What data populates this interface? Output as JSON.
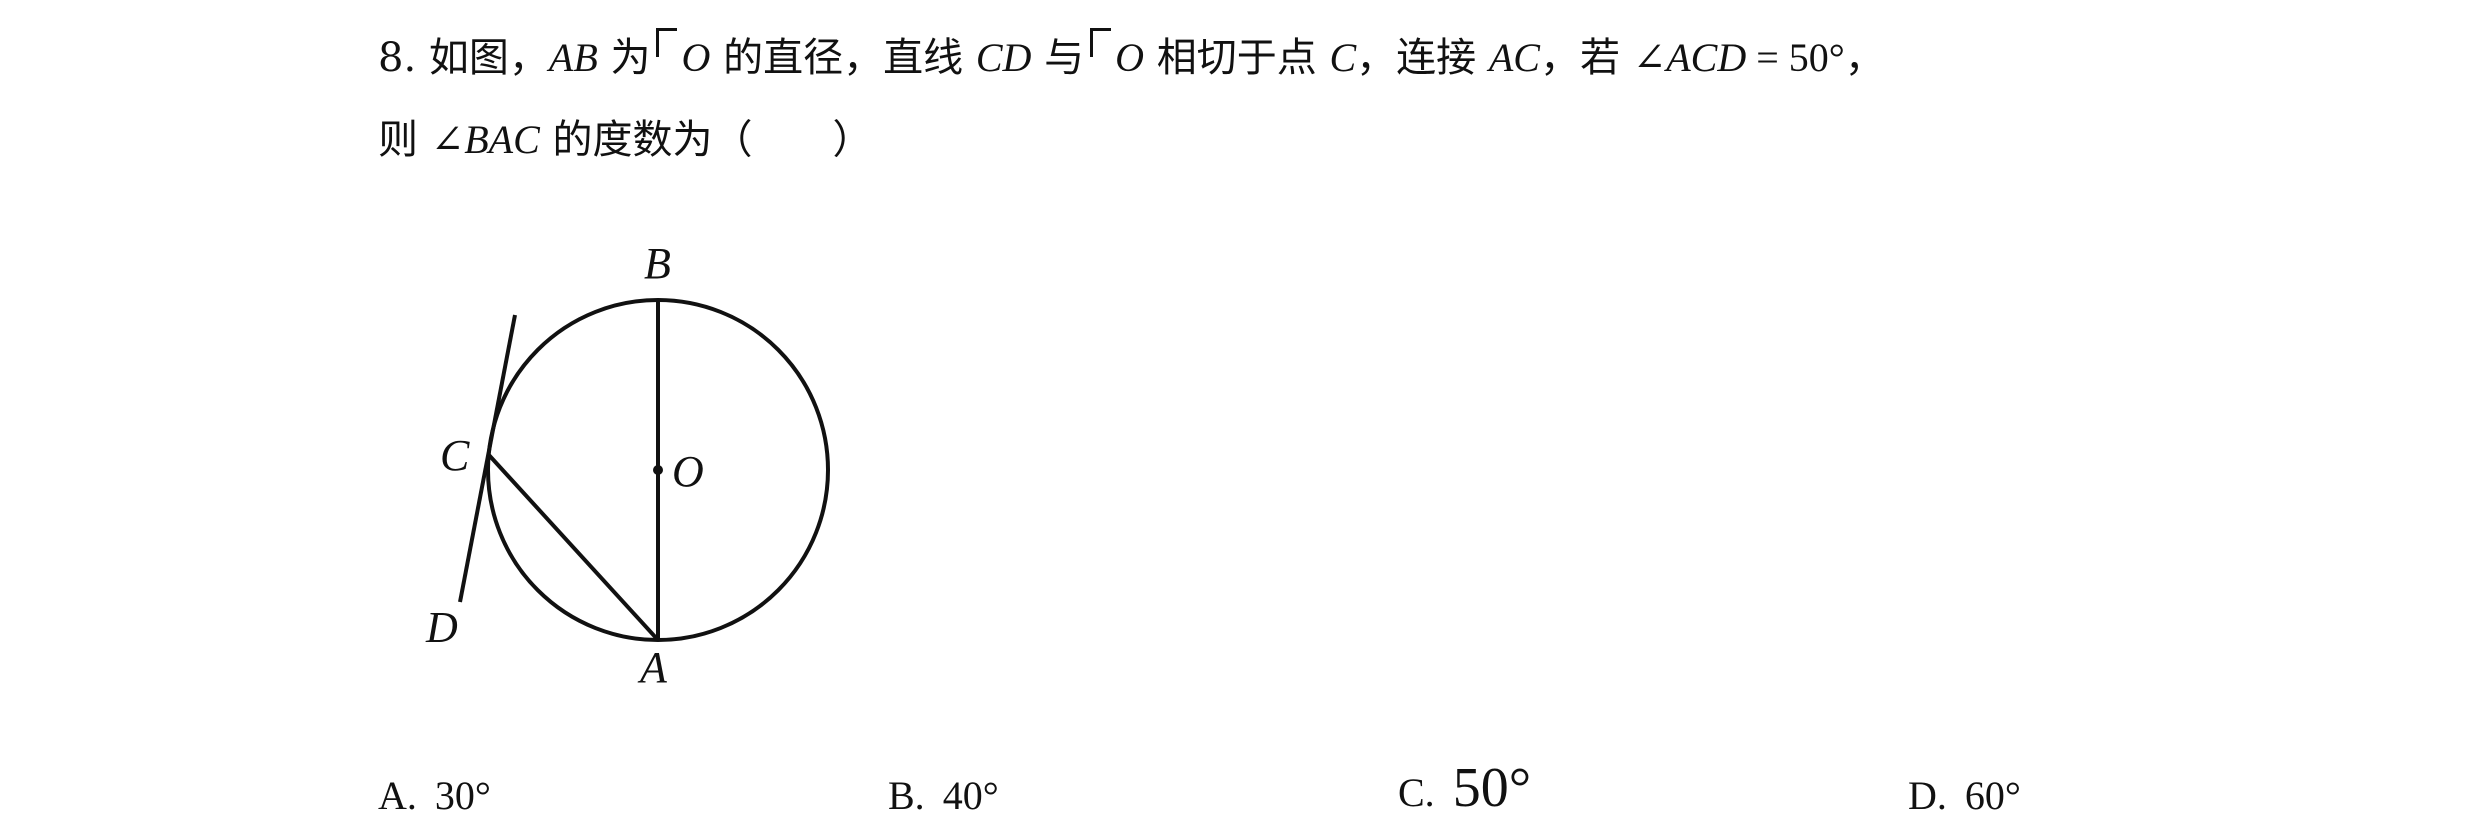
{
  "question": {
    "number": "8.",
    "line1": [
      {
        "t": "如图，",
        "s": "cjk"
      },
      {
        "t": "AB",
        "s": "math"
      },
      {
        "t": " 为",
        "s": "cjk"
      },
      {
        "t": "",
        "s": "circ"
      },
      {
        "t": "O",
        "s": "math"
      },
      {
        "t": " 的直径，直线 ",
        "s": "cjk"
      },
      {
        "t": "CD",
        "s": "math"
      },
      {
        "t": " 与",
        "s": "cjk"
      },
      {
        "t": "",
        "s": "circ"
      },
      {
        "t": "O",
        "s": "math"
      },
      {
        "t": " 相切于点 ",
        "s": "cjk"
      },
      {
        "t": "C",
        "s": "math"
      },
      {
        "t": "，连接 ",
        "s": "cjk"
      },
      {
        "t": "AC",
        "s": "math"
      },
      {
        "t": "，若 ",
        "s": "cjk"
      },
      {
        "t": "∠ACD",
        "s": "math"
      },
      {
        "t": " = 50°，",
        "s": "upr"
      }
    ],
    "line2": [
      {
        "t": "则 ",
        "s": "cjk"
      },
      {
        "t": "∠BAC",
        "s": "math"
      },
      {
        "t": " 的度数为（　　）",
        "s": "cjk"
      }
    ]
  },
  "figure": {
    "labels": {
      "A": "A",
      "B": "B",
      "C": "C",
      "D": "D",
      "O": "O"
    }
  },
  "options": [
    {
      "letter": "A.",
      "value": "30°"
    },
    {
      "letter": "B.",
      "value": "40°"
    },
    {
      "letter": "C.",
      "value": "50°"
    },
    {
      "letter": "D.",
      "value": "60°"
    }
  ]
}
